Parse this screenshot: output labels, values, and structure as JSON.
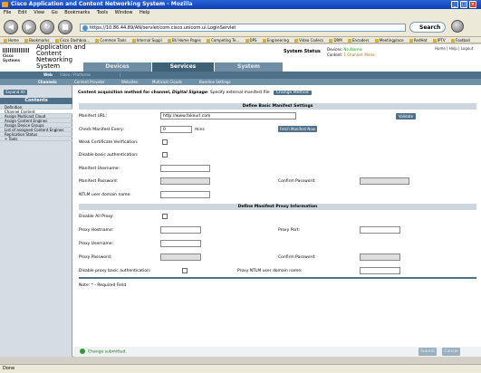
{
  "window": {
    "title": "Cisco Application and Content Networking System - Mozilla"
  },
  "menu": [
    "File",
    "Edit",
    "View",
    "Go",
    "Bookmarks",
    "Tools",
    "Window",
    "Help"
  ],
  "nav": {
    "url": "https://10.86.44.89/AN/servlet/com.cisco.unicorn.ui.LoginServlet",
    "search_label": "Search"
  },
  "bookmarks": [
    "Home",
    "Bookmarks",
    "Cisco Dashboa...",
    "Common Tools",
    "Internal Suppl",
    "BU Home Pages",
    "Competing Te...",
    "DPS",
    "Engineering",
    "Video Codecs",
    "DRM",
    "Encoders",
    "Meetingplace",
    "RedHat",
    "IPTV",
    "Football"
  ],
  "header": {
    "logo": "Cisco Systems",
    "app_title": "Application and Content Networking System",
    "tabs": [
      "Devices",
      "Services",
      "System"
    ],
    "active_tab": "Services",
    "system_status": "System Status",
    "devices_label": "Devices:",
    "devices_value": "No Alarms",
    "content_label": "Content:",
    "content_value": "1 Channel: Minor",
    "links": "Home | Help | Logout"
  },
  "subnav": {
    "items": [
      "Web",
      "Video / Platforms",
      "|"
    ],
    "active": "Web"
  },
  "subnav2": {
    "items": [
      "Channels",
      "Content Provider",
      "Websites",
      "Multicast Clouds",
      "Baseline Settings"
    ]
  },
  "sidebar": {
    "expand": "Expand All",
    "header": "Contents",
    "items": [
      "Definition",
      "Channel Content",
      "Assign Multicast Cloud",
      "Assign Content Engines",
      "Assign Device Groups",
      "List of assigned Content Engines",
      "Replication Status",
      "+ Tools"
    ]
  },
  "main": {
    "acq_prefix": "Content acquisition method for channel,",
    "channel_name": "Digital Signage",
    "acq_suffix": ": Specify external manifest file",
    "change_method": "Change Method",
    "basic_header": "Define Basic Manifest Settings",
    "manifest_url_label": "Manifest URL:",
    "manifest_url_value": "http://www.fakeurl.com",
    "validate": "Validate",
    "check_every_label": "Check Manifest Every:",
    "check_every_value": "0",
    "check_every_unit": "mins",
    "fetch": "Fetch Manifest Now",
    "weak_cert": "Weak Certificate Verification:",
    "disable_basic": "Disable basic authentication:",
    "manifest_user": "Manifest Username:",
    "manifest_pass": "Manifest Password:",
    "confirm_pass": "Confirm Password:",
    "ntlm_domain": "NTLM user domain name:",
    "proxy_header": "Define Manifest Proxy Information",
    "disable_proxy": "Disable All Proxy:",
    "proxy_host": "Proxy Hostname:",
    "proxy_port": "Proxy Port:",
    "proxy_user": "Proxy Username:",
    "proxy_pass": "Proxy Password:",
    "proxy_confirm": "Confirm Password:",
    "proxy_basic": "Disable proxy basic authentication:",
    "proxy_ntlm": "Proxy NTLM user domain name:",
    "note": "Note: * - Required Field"
  },
  "footer": {
    "saved": "Change submitted.",
    "submit": "Submit",
    "cancel": "Cancel"
  },
  "status": {
    "text": "Done"
  }
}
